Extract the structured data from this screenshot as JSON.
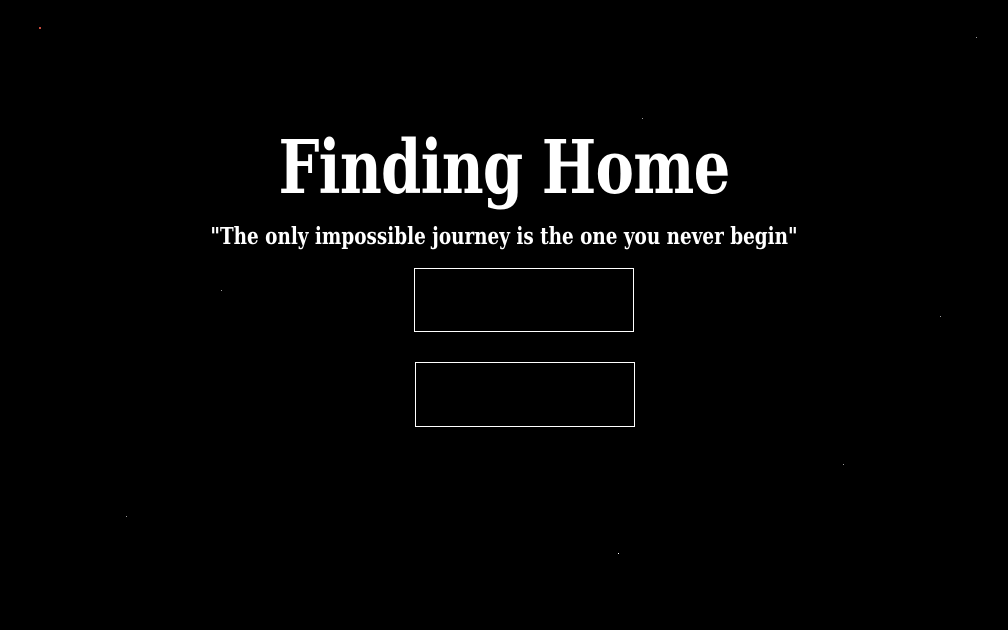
{
  "game": {
    "title": "Finding Home",
    "tagline": "\"The only impossible journey is the one you never begin\"",
    "menu": {
      "button_1_label": "",
      "button_2_label": ""
    }
  },
  "colors": {
    "background": "#000000",
    "text": "#ffffff",
    "button_border": "#ffffff",
    "star": "#ffffff",
    "red_star": "#c84a3c"
  }
}
